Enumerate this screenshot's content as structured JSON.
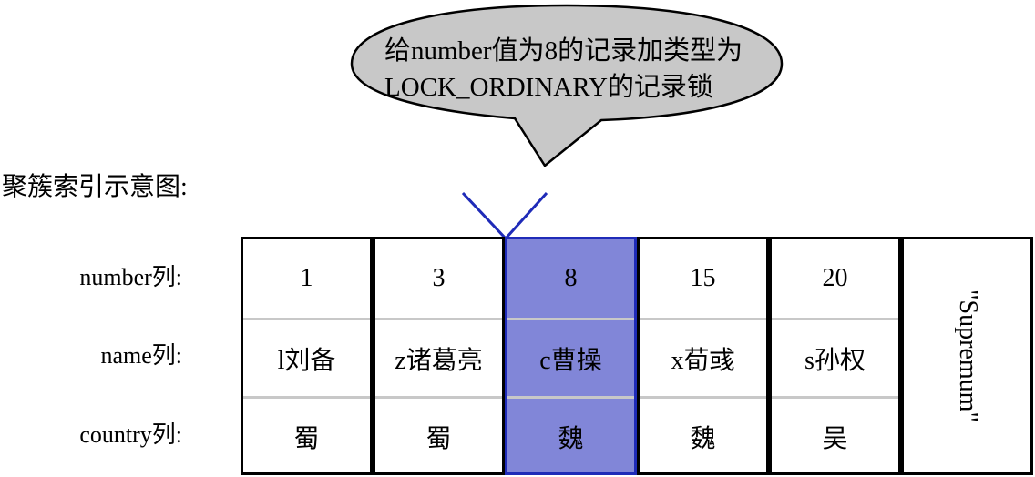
{
  "callout": {
    "line1": "给number值为8的记录加类型为",
    "line2": "LOCK_ORDINARY的记录锁"
  },
  "title": "聚簇索引示意图:",
  "row_labels": {
    "number": "number列:",
    "name": "name列:",
    "country": "country列:"
  },
  "records": [
    {
      "number": "1",
      "name": "l刘备",
      "country": "蜀"
    },
    {
      "number": "3",
      "name": "z诸葛亮",
      "country": "蜀"
    },
    {
      "number": "8",
      "name": "c曹操",
      "country": "魏"
    },
    {
      "number": "15",
      "name": "x荀彧",
      "country": "魏"
    },
    {
      "number": "20",
      "name": "s孙权",
      "country": "吴"
    }
  ],
  "locked_index": 2,
  "supremum": "\"Supremum\"",
  "colors": {
    "locked_fill": "#8186d8",
    "locked_border": "#1f2bb8",
    "callout_fill": "#c8c8c8",
    "arrow": "#1f2bb8"
  }
}
